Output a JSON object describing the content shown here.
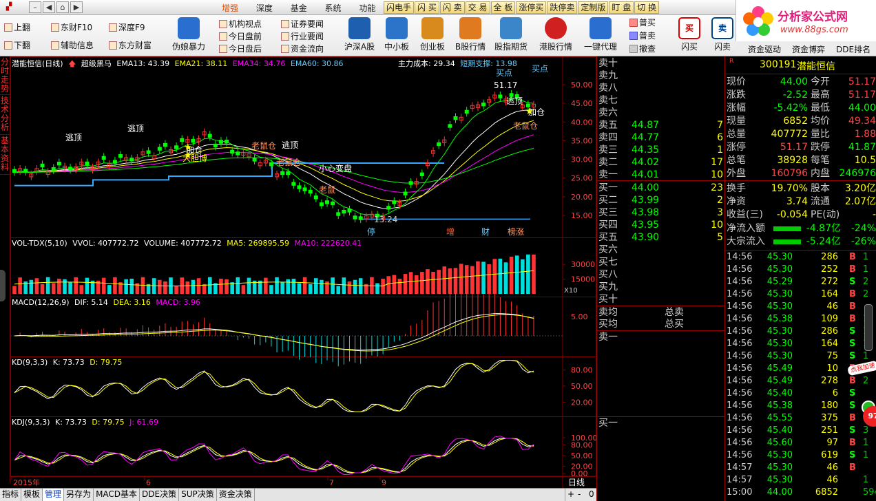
{
  "window": {
    "menu": [
      "增强",
      "深度",
      "基金",
      "系统",
      "功能"
    ],
    "active_menu": "增强",
    "quickbar": [
      "闪电手",
      "闪 买",
      "闪 卖",
      "交 易",
      "全 板",
      "涨停买",
      "跌停卖",
      "定制版",
      "盯 盘",
      "切 换"
    ]
  },
  "logo": {
    "title": "分析家公式网",
    "url": "www.88gs.com"
  },
  "toolbar": {
    "small_buttons": [
      "上翻",
      "下翻",
      "东财F10",
      "辅助信息",
      "深度F9",
      "东方财富",
      "机构视点",
      "今日盘前",
      "今日盘后",
      "证券要闻",
      "行业要闻",
      "资金流向"
    ],
    "big_buttons": [
      "伪娘暴力",
      "沪深A股",
      "中小板",
      "创业板",
      "B股行情",
      "股指期货",
      "港股行情",
      "一键代理",
      "闪买",
      "闪卖",
      "资金驱动",
      "资金博弈",
      "DDE排名"
    ],
    "order_buttons": [
      "普买",
      "普卖",
      "撤查"
    ]
  },
  "sidetabs": [
    "分时走势",
    "技术分析",
    "基本资料"
  ],
  "main_panel": {
    "title": "潜能恒信(日线)",
    "indicator": "超级黑马",
    "ema13": "EMA13: 43.39",
    "ema21": "EMA21: 38.11",
    "ema34": "EMA34: 34.76",
    "ema60": "EMA60: 30.86",
    "cost": "主力成本: 29.34",
    "support": "短期支撑: 13.98",
    "yaxis": [
      "50.00",
      "45.00",
      "40.00",
      "35.00",
      "30.00",
      "25.00",
      "20.00",
      "15.00"
    ],
    "annotations": [
      "逃顶",
      "逃顶",
      "加仓",
      "大胆博",
      "老鼠仓",
      "逃顶",
      "老鼠仓",
      "小心变盘",
      "老鼠",
      "13.24",
      "51.17",
      "逃顶",
      "加仓",
      "老鼠仓",
      "买点",
      "买点"
    ],
    "markers": [
      "停",
      "增",
      "财",
      "榜涨"
    ]
  },
  "vol_panel": {
    "label": "VOL-TDX(5,10)",
    "vvol": "VVOL: 407772.72",
    "volume": "VOLUME: 407772.72",
    "ma5": "MA5: 269895.59",
    "ma10": "MA10: 222620.41",
    "yaxis": [
      "30000",
      "15000"
    ],
    "unit": "X10"
  },
  "macd_panel": {
    "label": "MACD(12,26,9)",
    "dif": "DIF: 5.14",
    "dea": "DEA: 3.16",
    "macd": "MACD: 3.96",
    "yaxis": [
      "5.00"
    ]
  },
  "kd_panel": {
    "label": "KD(9,3,3)",
    "k": "K: 73.73",
    "d": "D: 79.75",
    "yaxis": [
      "80.00",
      "50.00",
      "20.00"
    ]
  },
  "kdj_panel": {
    "label": "KDJ(9,3,3)",
    "k": "K: 73.73",
    "d": "D: 79.75",
    "j": "J: 61.69",
    "yaxis": [
      "100.00",
      "80.00",
      "50.00",
      "20.00",
      "0.00"
    ]
  },
  "xaxis": [
    "2015年",
    "6",
    "7",
    "9"
  ],
  "period": "日线",
  "bottom_tabs": [
    "指标",
    "模板",
    "管理",
    "另存为",
    "MACD基本",
    "DDE决策",
    "SUP决策",
    "资金决策"
  ],
  "active_bottom_tab": "管理",
  "zoom_controls": [
    "+",
    "-",
    "0"
  ],
  "book": {
    "sells": [
      {
        "label": "卖十",
        "price": "",
        "vol": ""
      },
      {
        "label": "卖九",
        "price": "",
        "vol": ""
      },
      {
        "label": "卖八",
        "price": "",
        "vol": ""
      },
      {
        "label": "卖七",
        "price": "",
        "vol": ""
      },
      {
        "label": "卖六",
        "price": "",
        "vol": ""
      },
      {
        "label": "卖五",
        "price": "44.87",
        "vol": "7"
      },
      {
        "label": "卖四",
        "price": "44.77",
        "vol": "6"
      },
      {
        "label": "卖三",
        "price": "44.35",
        "vol": "1"
      },
      {
        "label": "卖二",
        "price": "44.02",
        "vol": "17"
      },
      {
        "label": "卖一",
        "price": "44.01",
        "vol": "10"
      }
    ],
    "buys": [
      {
        "label": "买一",
        "price": "44.00",
        "vol": "23"
      },
      {
        "label": "买二",
        "price": "43.99",
        "vol": "2"
      },
      {
        "label": "买三",
        "price": "43.98",
        "vol": "3"
      },
      {
        "label": "买四",
        "price": "43.95",
        "vol": "10"
      },
      {
        "label": "买五",
        "price": "43.90",
        "vol": "5"
      },
      {
        "label": "买六",
        "price": "",
        "vol": ""
      },
      {
        "label": "买七",
        "price": "",
        "vol": ""
      },
      {
        "label": "买八",
        "price": "",
        "vol": ""
      },
      {
        "label": "买九",
        "price": "",
        "vol": ""
      },
      {
        "label": "买十",
        "price": "",
        "vol": ""
      }
    ],
    "avg_sell": "卖均",
    "avg_buy": "买均",
    "total_sell": "总卖",
    "total_buy": "总买",
    "queue_sell": "卖一",
    "queue_buy": "买一"
  },
  "quote": {
    "badge": "R",
    "code": "300191",
    "name": "潜能恒信",
    "rows": [
      {
        "a": "现价",
        "av": "44.00",
        "ac": "green",
        "b": "今开",
        "bv": "51.17",
        "bc": "red"
      },
      {
        "a": "涨跌",
        "av": "-2.52",
        "ac": "green",
        "b": "最高",
        "bv": "51.17",
        "bc": "red"
      },
      {
        "a": "涨幅",
        "av": "-5.42%",
        "ac": "green",
        "b": "最低",
        "bv": "44.00",
        "bc": "green"
      },
      {
        "a": "现量",
        "av": "6852",
        "ac": "yellow",
        "b": "均价",
        "bv": "49.34",
        "bc": "red"
      },
      {
        "a": "总量",
        "av": "407772",
        "ac": "yellow",
        "b": "量比",
        "bv": "1.88",
        "bc": "red"
      },
      {
        "a": "涨停",
        "av": "51.17",
        "ac": "red",
        "b": "跌停",
        "bv": "41.87",
        "bc": "green"
      },
      {
        "a": "总笔",
        "av": "38928",
        "ac": "yellow",
        "b": "每笔",
        "bv": "10.5",
        "bc": "yellow"
      },
      {
        "a": "外盘",
        "av": "160796",
        "ac": "red",
        "b": "内盘",
        "bv": "246976",
        "bc": "green"
      }
    ],
    "rows2": [
      {
        "a": "换手",
        "av": "19.70%",
        "ac": "yellow",
        "b": "股本",
        "bv": "3.20亿",
        "bc": "yellow"
      },
      {
        "a": "净资",
        "av": "3.74",
        "ac": "yellow",
        "b": "流通",
        "bv": "2.07亿",
        "bc": "yellow"
      },
      {
        "a": "收益(三)",
        "av": "-0.054",
        "ac": "yellow",
        "b": "PE(动)",
        "bv": "-",
        "bc": "yellow"
      }
    ],
    "flows": [
      {
        "label": "净流入额",
        "value": "-4.87亿",
        "pct": "-24%"
      },
      {
        "label": "大宗流入",
        "value": "-5.24亿",
        "pct": "-26%"
      }
    ],
    "ticks": [
      {
        "t": "14:56",
        "p": "45.30",
        "pc": "green",
        "v": "286",
        "v_c": "yellow",
        "bs": "B",
        "x": "1"
      },
      {
        "t": "14:56",
        "p": "45.30",
        "pc": "green",
        "v": "252",
        "v_c": "yellow",
        "bs": "B",
        "x": "1"
      },
      {
        "t": "14:56",
        "p": "45.29",
        "pc": "green",
        "v": "272",
        "v_c": "yellow",
        "bs": "S",
        "x": "2"
      },
      {
        "t": "14:56",
        "p": "45.30",
        "pc": "green",
        "v": "164",
        "v_c": "yellow",
        "bs": "B",
        "x": "2"
      },
      {
        "t": "14:56",
        "p": "45.30",
        "pc": "green",
        "v": "46",
        "v_c": "yellow",
        "bs": "B",
        "x": ""
      },
      {
        "t": "14:56",
        "p": "45.38",
        "pc": "green",
        "v": "109",
        "v_c": "yellow",
        "bs": "B",
        "x": "1"
      },
      {
        "t": "14:56",
        "p": "45.30",
        "pc": "green",
        "v": "286",
        "v_c": "yellow",
        "bs": "S",
        "x": "1"
      },
      {
        "t": "14:56",
        "p": "45.30",
        "pc": "green",
        "v": "164",
        "v_c": "yellow",
        "bs": "S",
        "x": "1"
      },
      {
        "t": "14:56",
        "p": "45.30",
        "pc": "green",
        "v": "75",
        "v_c": "yellow",
        "bs": "S",
        "x": "1"
      },
      {
        "t": "14:56",
        "p": "45.49",
        "pc": "green",
        "v": "10",
        "v_c": "yellow",
        "bs": "B",
        "x": "2"
      },
      {
        "t": "14:56",
        "p": "45.49",
        "pc": "green",
        "v": "278",
        "v_c": "yellow",
        "bs": "B",
        "x": "2"
      },
      {
        "t": "14:56",
        "p": "45.40",
        "pc": "green",
        "v": "6",
        "v_c": "yellow",
        "bs": "S",
        "x": ""
      },
      {
        "t": "14:56",
        "p": "45.38",
        "pc": "green",
        "v": "180",
        "v_c": "yellow",
        "bs": "S",
        "x": ""
      },
      {
        "t": "14:56",
        "p": "45.55",
        "pc": "green",
        "v": "375",
        "v_c": "yellow",
        "bs": "B",
        "x": ""
      },
      {
        "t": "14:56",
        "p": "45.40",
        "pc": "green",
        "v": "251",
        "v_c": "yellow",
        "bs": "S",
        "x": "3"
      },
      {
        "t": "14:56",
        "p": "45.60",
        "pc": "green",
        "v": "97",
        "v_c": "yellow",
        "bs": "B",
        "x": "1"
      },
      {
        "t": "14:56",
        "p": "45.30",
        "pc": "green",
        "v": "619",
        "v_c": "mag",
        "bs": "S",
        "x": "1"
      },
      {
        "t": "14:57",
        "p": "45.30",
        "pc": "green",
        "v": "46",
        "v_c": "yellow",
        "bs": "B",
        "x": ""
      },
      {
        "t": "14:57",
        "p": "45.30",
        "pc": "green",
        "v": "46",
        "v_c": "yellow",
        "bs": "",
        "x": "1"
      },
      {
        "t": "15:00",
        "p": "44.00",
        "pc": "green",
        "v": "6852",
        "v_c": "mag",
        "bs": "",
        "x": "594"
      }
    ],
    "float_badge": "点我加速",
    "float_num": "97"
  },
  "colors": {
    "up": "#ff3333",
    "down": "#00ff00",
    "accent": "#ffff00",
    "grid": "#800000",
    "ema13": "#ffffff",
    "ema21": "#ffff00",
    "ema34": "#ff00ff",
    "ema60": "#00ff00",
    "cost": "#33aaff"
  }
}
